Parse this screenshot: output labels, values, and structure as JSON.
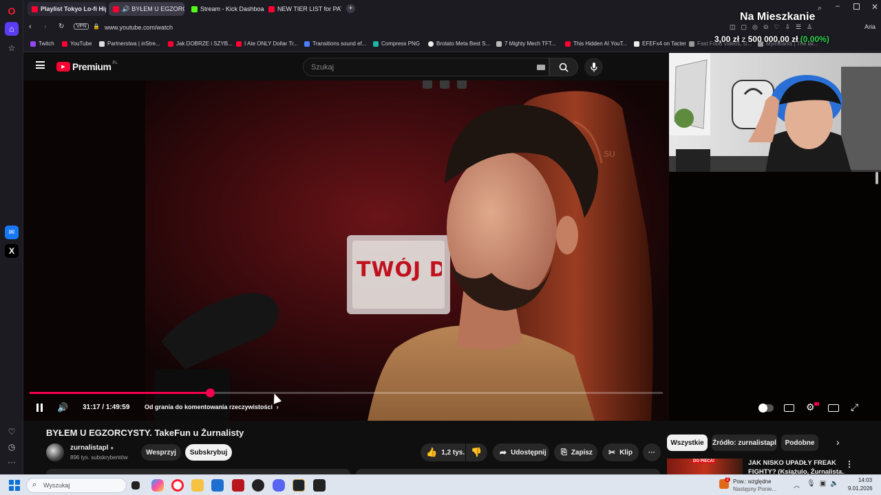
{
  "browser": {
    "tabs": [
      {
        "label": "Playlist Tokyo Lo-fi Hiphop",
        "color": "#ff0033"
      },
      {
        "label": "BYŁEM U EGZORCYSTY",
        "color": "#ff0033"
      },
      {
        "label": "Stream - Kick Dashboard",
        "color": "#53fc18"
      },
      {
        "label": "NEW TIER LIST for PATCH",
        "color": "#ff0033"
      }
    ],
    "vpn": "VPN",
    "url": "www.youtube.com/watch",
    "bookmarks": [
      {
        "label": "Twitch",
        "color": "#9146ff"
      },
      {
        "label": "YouTube",
        "color": "#ff0033"
      },
      {
        "label": "Partnerstwa | inStre...",
        "color": "#dddddd"
      },
      {
        "label": "Jak DOBRZE i SZYB...",
        "color": "#ff0033"
      },
      {
        "label": "I Ate ONLY Dollar Tr...",
        "color": "#ff0033"
      },
      {
        "label": "Transitions sound ef...",
        "color": "#4a7cff"
      },
      {
        "label": "Compress PNG",
        "color": "#1fb6a8"
      },
      {
        "label": "Brotato Meta Best S...",
        "color": "#eeeeee"
      },
      {
        "label": "7 Mighty Mech TFT...",
        "color": "#bbbbbb"
      },
      {
        "label": "This Hidden AI YouT...",
        "color": "#ff0033"
      },
      {
        "label": "EFEFx4 on Tacter",
        "color": "#eeeeee"
      },
      {
        "label": "Fast Food Videos, D...",
        "color": "#999999"
      },
      {
        "label": "Myinstants | The lar...",
        "color": "#999999"
      }
    ]
  },
  "overlay": {
    "goal_title": "Na Mieszkanie",
    "goal_current": "3,00 zł",
    "goal_sep": "z",
    "goal_target": "500 000,00 zł",
    "goal_percent": "(0.00%)"
  },
  "youtube": {
    "logo": "Premium",
    "logo_sup": "PL",
    "search_placeholder": "Szukaj",
    "player": {
      "time": "31:17 / 1:49:59",
      "chapter": "Od grania do komentowania rzeczywistości",
      "chapter_arrow": "›",
      "progress": 0.2845,
      "sign_text": "TWÓJ D",
      "chair_text": "SU"
    },
    "video_title": "BYŁEM U EGZORCYSTY. TakeFun u Żurnalisty",
    "channel": {
      "name": "zurnalistapl",
      "subs": "896 tys. subskrybentów"
    },
    "buttons": {
      "join": "Wesprzyj",
      "subscribe": "Subskrybuj",
      "likes": "1,2 tys.",
      "share": "Udostępnij",
      "save": "Zapisz",
      "clip": "Klip",
      "more": "···"
    },
    "filter_chips": [
      "Wszystkie",
      "Źródło: zurnalistapl",
      "Podobne"
    ],
    "recommended": {
      "title_line1": "JAK NISKO UPADŁY FREAK",
      "title_line2": "FIGHTY? (Książulo, Żurnalista...",
      "thumb_text": "DO PIECA!"
    }
  },
  "taskbar": {
    "search_placeholder": "Wyszukaj",
    "weather_line1": "Pow.: względne",
    "weather_line2": "Następny Ponie...",
    "time": "14:03",
    "date": "9.01.2026",
    "badge_count": "2"
  }
}
